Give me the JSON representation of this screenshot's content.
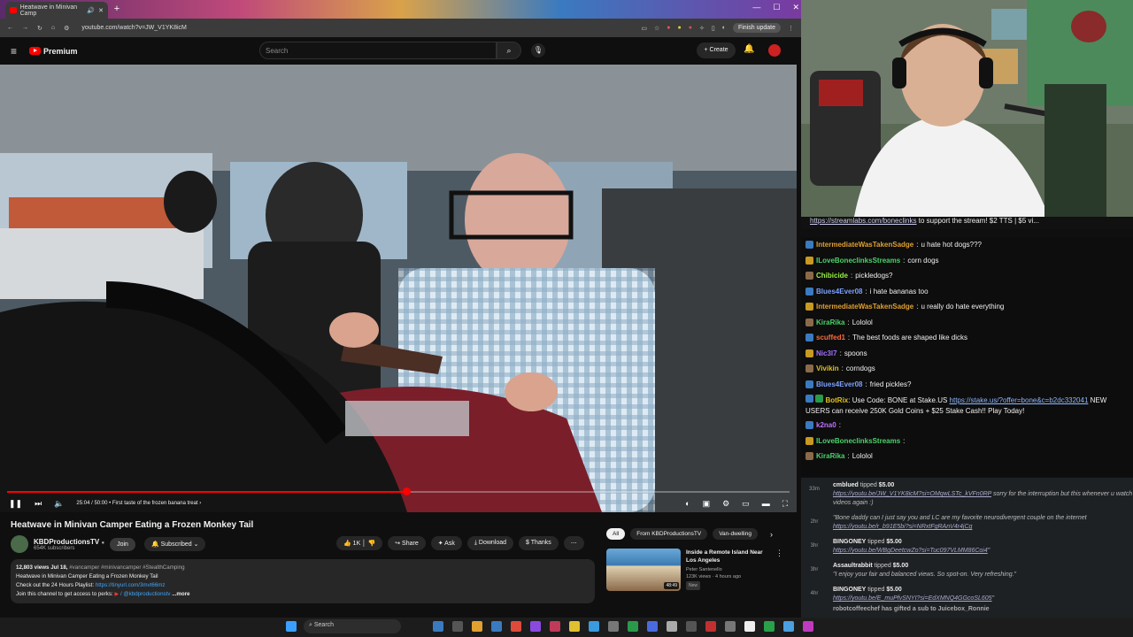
{
  "browser": {
    "tab_title": "Heatwave in Minivan Camp",
    "url": "youtube.com/watch?v=JW_V1YK8icM",
    "finish_update": "Finish update"
  },
  "yt_header": {
    "logo_text": "Premium",
    "search_placeholder": "Search",
    "create_label": "Create"
  },
  "player": {
    "time": "25:04 / 50:00",
    "chapter": "First taste of the frozen banana treat",
    "progress_fraction": 0.51
  },
  "video": {
    "title": "Heatwave in Minivan Camper Eating a Frozen Monkey Tail",
    "channel": "KBDProductionsTV",
    "subscribers": "654K subscribers",
    "join_label": "Join",
    "subscribed_label": "Subscribed",
    "like_count": "1K",
    "share_label": "Share",
    "ask_label": "Ask",
    "download_label": "Download",
    "thanks_label": "Thanks",
    "desc_views": "12,803 views  Jul 18,",
    "desc_tags": "#vancamper #minivancamper #StealthCamping",
    "desc_line1": "Heatwave in Minivan Camper Eating a Frozen Monkey Tail",
    "desc_line2_prefix": "Check out the 24 Hours Playlist:",
    "desc_line2_link": "https://tinyurl.com/3mvt66mz",
    "desc_line3": "Join this channel to get access to perks:",
    "desc_line3_link": "/ @kbdproductionstv",
    "desc_more": "...more"
  },
  "recommendations": {
    "chips": [
      "All",
      "From KBDProductionsTV",
      "Van-dwelling"
    ],
    "item": {
      "title": "Inside a Remote Island Near Los Angeles",
      "channel": "Peter Santenello",
      "meta": "123K views · 4 hours ago",
      "badge": "New",
      "duration": "48:49"
    }
  },
  "stream": {
    "banner_link": "https://streamlabs.com/boneclinks",
    "banner_text": " to support the stream! $2 TTS | $5 vi..."
  },
  "chat": [
    {
      "user": "IntermediateWasTakenSadge",
      "color": "#e0a030",
      "msg": "u hate hot dogs???"
    },
    {
      "user": "ILoveBoneclinksStreams",
      "color": "#4bd36a",
      "msg": "corn dogs"
    },
    {
      "user": "Chibicide",
      "color": "#9aee44",
      "msg": "pickledogs?"
    },
    {
      "user": "Blues4Ever08",
      "color": "#7aa0ff",
      "msg": "i hate bananas too"
    },
    {
      "user": "IntermediateWasTakenSadge",
      "color": "#e0a030",
      "msg": "u really do hate everything"
    },
    {
      "user": "KiraRika",
      "color": "#4bd36a",
      "msg": "Lololol"
    },
    {
      "user": "scuffed1",
      "color": "#ff6a3a",
      "msg": "The best foods are shaped like dicks"
    },
    {
      "user": "Nic3l7",
      "color": "#a070ff",
      "msg": "spoons"
    },
    {
      "user": "Vivikin",
      "color": "#e0c020",
      "msg": "corndogs"
    },
    {
      "user": "Blues4Ever08",
      "color": "#7aa0ff",
      "msg": "fried pickles?"
    }
  ],
  "chat_bot": {
    "user": "BotRix",
    "pre": "Use Code: BONE at Stake.US ",
    "link": "https://stake.us/?offer=bone&c=b2dc332041",
    "post": " NEW USERS can receive 250K Gold Coins + $25 Stake Cash!! Play Today!"
  },
  "chat_tail": [
    {
      "user": "k2na0",
      "color": "#c070ff",
      "msg": ""
    },
    {
      "user": "ILoveBoneclinksStreams",
      "color": "#4bd36a",
      "msg": ""
    },
    {
      "user": "KiraRika",
      "color": "#4bd36a",
      "msg": "Lololol"
    }
  ],
  "tips": [
    {
      "time": "33m",
      "name": "cmblued",
      "verb": " tipped ",
      "amount": "$5.00",
      "link": "https://youtu.be/JW_V1YK8icM?si=OMqwLSTc_kVFn0RP",
      "msg": " sorry for the interruption but this whenever u watch videos again :)"
    },
    {
      "time": "2hr",
      "name": "",
      "verb": "",
      "amount": "",
      "link": "",
      "msg": "\"Bone daddy can I just say you and LC are my favorite neurodivergent couple on the internet",
      "link2": "https://youtu.be/r_b91E5bi?si=NRxtFgRAnV4r4jCg"
    },
    {
      "time": "3hr",
      "name": "BINGONEY",
      "verb": " tipped ",
      "amount": "$5.00",
      "link": "https://youtu.be/WBgDeetcwZo?si=Tuc097VLMM86Coi4",
      "msg": "\""
    },
    {
      "time": "3hr",
      "name": "Assaultrabbit",
      "verb": " tipped ",
      "amount": "$5.00",
      "link": "",
      "msg": "\"I enjoy your fair and balanced views. So spot-on. Very refreshing.\""
    },
    {
      "time": "4hr",
      "name": "BINGONEY",
      "verb": " tipped ",
      "amount": "$5.00",
      "link": "https://youtu.be/E_muPfvSNYI?si=EdXMNQ4GGcoSL605",
      "msg": "\""
    }
  ],
  "tips_footer": "robotcoffeechef has gifted a sub to Juicebox_Ronnie",
  "taskbar": {
    "search_placeholder": "Search"
  }
}
